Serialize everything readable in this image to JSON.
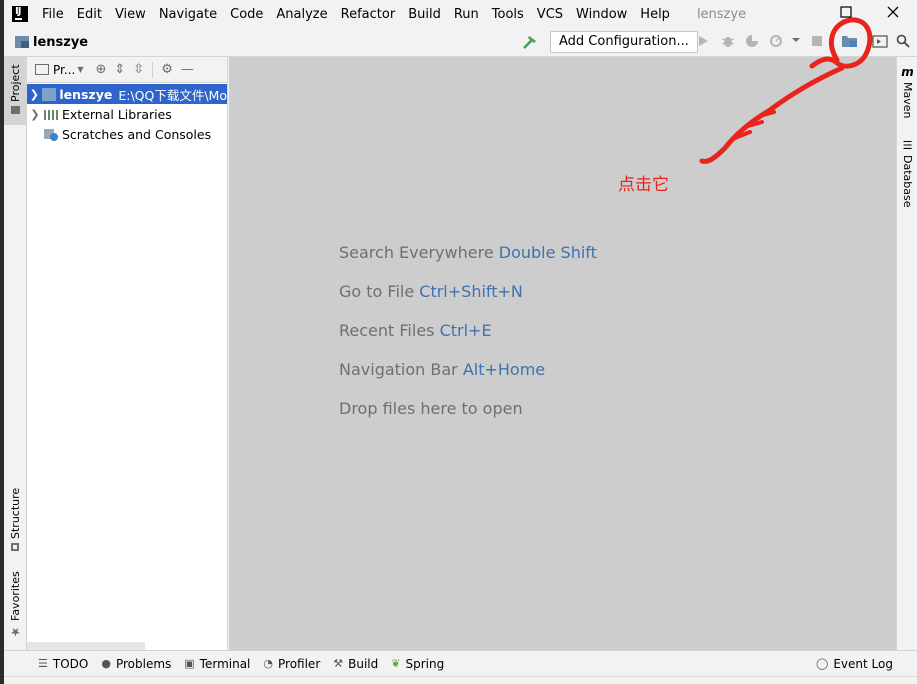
{
  "menubar": {
    "items": [
      "File",
      "Edit",
      "View",
      "Navigate",
      "Code",
      "Analyze",
      "Refactor",
      "Build",
      "Run",
      "Tools",
      "VCS",
      "Window",
      "Help"
    ],
    "project_title": "lenszye"
  },
  "navbar": {
    "project_name": "lenszye",
    "add_configuration": "Add Configuration..."
  },
  "left_strip": {
    "project_tab": "Project",
    "structure_tab": "Structure",
    "favorites_tab": "Favorites"
  },
  "project_panel": {
    "view_selector": "Pr...",
    "tree": [
      {
        "label": "lenszye",
        "path": "E:\\QQ下载文件\\Mo",
        "selected": true
      },
      {
        "label": "External Libraries",
        "path": "",
        "selected": false
      },
      {
        "label": "Scratches and Consoles",
        "path": "",
        "selected": false
      }
    ]
  },
  "editor_hints": [
    {
      "text": "Search Everywhere ",
      "key": "Double Shift"
    },
    {
      "text": "Go to File ",
      "key": "Ctrl+Shift+N"
    },
    {
      "text": "Recent Files ",
      "key": "Ctrl+E"
    },
    {
      "text": "Navigation Bar ",
      "key": "Alt+Home"
    },
    {
      "text": "Drop files here to open",
      "key": ""
    }
  ],
  "right_strip": {
    "maven_tab": "Maven",
    "database_tab": "Database"
  },
  "bottom_tools": [
    "TODO",
    "Problems",
    "Terminal",
    "Profiler",
    "Build",
    "Spring"
  ],
  "event_log": "Event Log",
  "annotation": {
    "text": "点击它",
    "color": "#e8241c"
  },
  "colors": {
    "selection": "#2f65ca",
    "hint_key": "#3f72b0",
    "editor_bg": "#cdcdcd",
    "build_hammer": "#499c54"
  }
}
